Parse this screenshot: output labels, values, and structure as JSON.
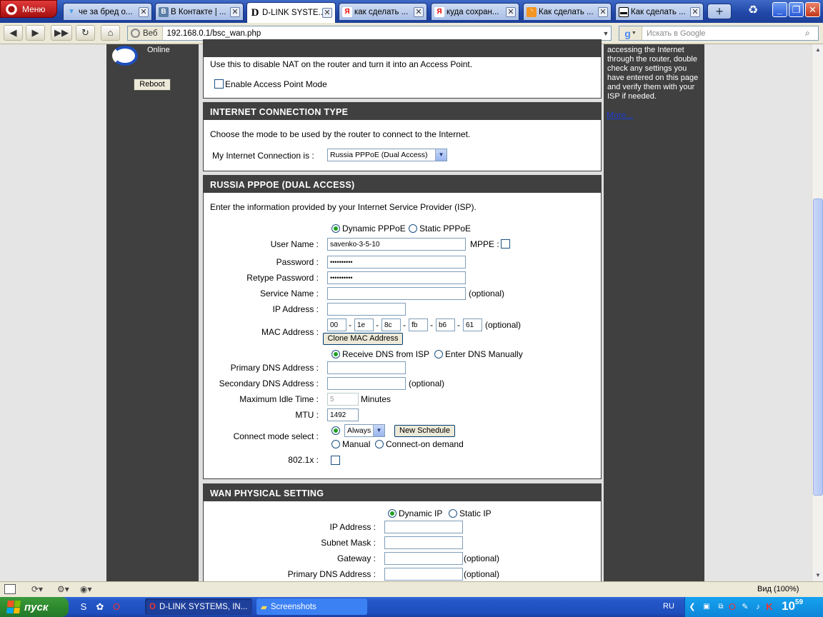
{
  "browser": {
    "menu_label": "Меню",
    "tabs": [
      {
        "label": "че за бред о...",
        "icon": "vkontakte-alt-icon"
      },
      {
        "label": "В Контакте | ...",
        "icon": "vkontakte-icon"
      },
      {
        "label": "D-LINK SYSTE...",
        "icon": "dlink-icon",
        "active": true
      },
      {
        "label": "как сделать ...",
        "icon": "yandex-icon"
      },
      {
        "label": "куда сохран...",
        "icon": "yandex-icon"
      },
      {
        "label": "Как сделать ...",
        "icon": "rss-icon"
      },
      {
        "label": "Как сделать ...",
        "icon": "gun-icon"
      }
    ],
    "address": {
      "web_label": "Веб",
      "url": "192.168.0.1/bsc_wan.php"
    },
    "search_placeholder": "Искать в Google",
    "zoom_label": "Вид (100%)"
  },
  "router": {
    "left": {
      "status": "Online",
      "reboot": "Reboot"
    },
    "help": {
      "text": "accessing the Internet through the router, double check any settings you have entered on this page and verify them with your ISP if needed.",
      "more": "More..."
    },
    "ap_mode": {
      "desc": "Use this to disable NAT on the router and turn it into an Access Point.",
      "checkbox_label": "Enable Access Point Mode"
    },
    "conn_type": {
      "title": "INTERNET CONNECTION TYPE",
      "desc": "Choose the mode to be used by the router to connect to the Internet.",
      "label": "My Internet Connection is :",
      "value": "Russia PPPoE (Dual Access)"
    },
    "pppoe": {
      "title": "RUSSIA PPPOE (DUAL ACCESS)",
      "desc": "Enter the information provided by your Internet Service Provider (ISP).",
      "dynamic": "Dynamic PPPoE",
      "static": "Static PPPoE",
      "username_label": "User Name :",
      "username": "savenko-3-5-10",
      "mppe_label": "MPPE :",
      "password_label": "Password :",
      "password": "••••••••••",
      "retype_label": "Retype Password :",
      "retype": "••••••••••",
      "service_label": "Service Name :",
      "optional": "(optional)",
      "ip_label": "IP Address :",
      "mac_label": "MAC Address :",
      "mac": [
        "00",
        "1e",
        "8c",
        "fb",
        "b6",
        "61"
      ],
      "mac_sep": "-",
      "clone_mac": "Clone MAC Address",
      "dns_receive": "Receive DNS from ISP",
      "dns_manual": "Enter DNS Manually",
      "primary_dns_label": "Primary DNS Address :",
      "secondary_dns_label": "Secondary DNS Address :",
      "idle_label": "Maximum Idle Time :",
      "idle_value": "5",
      "idle_unit": "Minutes",
      "mtu_label": "MTU :",
      "mtu": "1492",
      "connect_label": "Connect mode select :",
      "connect_value": "Always",
      "new_schedule": "New Schedule",
      "manual": "Manual",
      "on_demand": "Connect-on demand",
      "dot1x_label": "802.1x :"
    },
    "wan": {
      "title": "WAN PHYSICAL SETTING",
      "dynamic": "Dynamic IP",
      "static": "Static IP",
      "ip_label": "IP Address :",
      "mask_label": "Subnet Mask :",
      "gateway_label": "Gateway :",
      "dns_label": "Primary DNS Address :",
      "optional": "(optional)"
    }
  },
  "taskbar": {
    "start": "пуск",
    "tasks": [
      {
        "label": "D-LINK SYSTEMS, IN...",
        "icon": "opera-icon"
      },
      {
        "label": "Screenshots",
        "icon": "folder-icon"
      }
    ],
    "lang": "RU",
    "clock_hour": "10",
    "clock_min": "59"
  },
  "colors": {
    "section_header": "#404040",
    "sidebar": "#404040",
    "accent": "#21a121",
    "taskbar": "#2457c8"
  }
}
